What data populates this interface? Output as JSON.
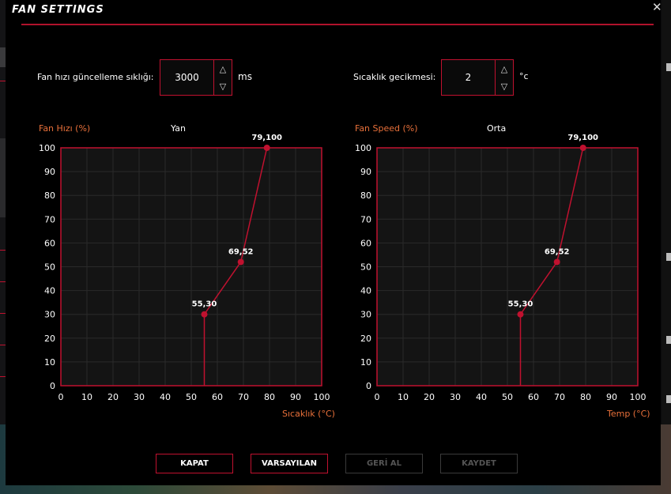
{
  "window": {
    "title": "FAN SETTINGS",
    "close_glyph": "✕"
  },
  "settings": {
    "update_label": "Fan hızı güncelleme sıklığı:",
    "update_value": "3000",
    "update_unit": "ms",
    "delay_label": "Sıcaklık gecikmesi:",
    "delay_value": "2",
    "delay_unit": "°c",
    "up_glyph": "△",
    "down_glyph": "▽"
  },
  "colors": {
    "accent": "#c0112f",
    "axis_label": "#e8703a",
    "plot_bg": "#141414",
    "grid": "#2a2a2a"
  },
  "chart_data": [
    {
      "type": "line",
      "title": "Yan",
      "ylabel": "Fan Hızı (%)",
      "xlabel": "Sıcaklık (°C)",
      "xlim": [
        0,
        100
      ],
      "ylim": [
        0,
        100
      ],
      "xticks": [
        "0",
        "10",
        "20",
        "30",
        "40",
        "50",
        "60",
        "70",
        "80",
        "90",
        "100"
      ],
      "yticks": [
        "0",
        "10",
        "20",
        "30",
        "40",
        "50",
        "60",
        "70",
        "80",
        "90",
        "100"
      ],
      "points": [
        {
          "x": 55,
          "y": 0
        },
        {
          "x": 55,
          "y": 30
        },
        {
          "x": 69,
          "y": 52
        },
        {
          "x": 79,
          "y": 100
        }
      ],
      "labels": [
        {
          "x": 55,
          "y": 30,
          "text": "55,30"
        },
        {
          "x": 69,
          "y": 52,
          "text": "69,52"
        },
        {
          "x": 79,
          "y": 100,
          "text": "79,100"
        }
      ],
      "grid": true
    },
    {
      "type": "line",
      "title": "Orta",
      "ylabel": "Fan Speed (%)",
      "xlabel": "Temp (°C)",
      "xlim": [
        0,
        100
      ],
      "ylim": [
        0,
        100
      ],
      "xticks": [
        "0",
        "10",
        "20",
        "30",
        "40",
        "50",
        "60",
        "70",
        "80",
        "90",
        "100"
      ],
      "yticks": [
        "0",
        "10",
        "20",
        "30",
        "40",
        "50",
        "60",
        "70",
        "80",
        "90",
        "100"
      ],
      "points": [
        {
          "x": 55,
          "y": 0
        },
        {
          "x": 55,
          "y": 30
        },
        {
          "x": 69,
          "y": 52
        },
        {
          "x": 79,
          "y": 100
        }
      ],
      "labels": [
        {
          "x": 55,
          "y": 30,
          "text": "55,30"
        },
        {
          "x": 69,
          "y": 52,
          "text": "69,52"
        },
        {
          "x": 79,
          "y": 100,
          "text": "79,100"
        }
      ],
      "grid": true
    }
  ],
  "buttons": {
    "close": "KAPAT",
    "defaults": "VARSAYILAN",
    "undo": "GERİ AL",
    "save": "KAYDET"
  }
}
